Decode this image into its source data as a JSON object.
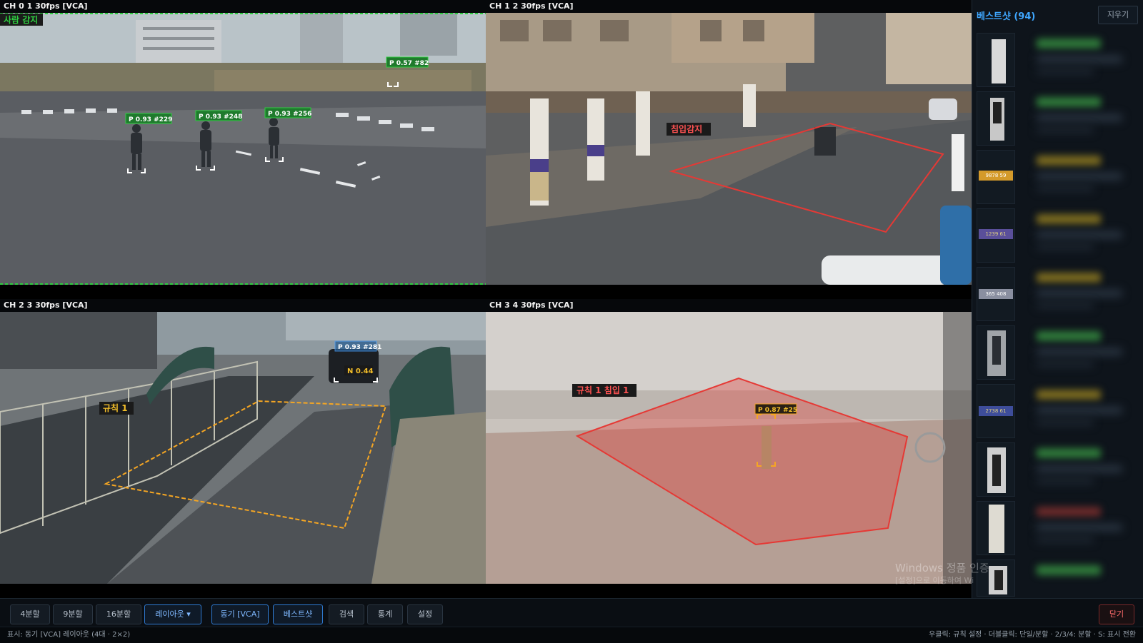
{
  "channels": [
    {
      "header": "CH 0  1   30fps [VCA]",
      "event": "사람 감지",
      "detections": [
        "P 0.57 #82",
        "P 0.93 #229",
        "P 0.93 #248",
        "P 0.93 #256"
      ]
    },
    {
      "header": "CH 1  2   30fps [VCA]",
      "event": "침입감지"
    },
    {
      "header": "CH 2  3   30fps [VCA]",
      "rule": "규칙 1",
      "detections": [
        "P 0.93 #281",
        "N 0.44"
      ]
    },
    {
      "header": "CH 3  4   30fps [VCA]",
      "rule": "규칙 1  침입 1",
      "detections": [
        "P 0.87 #25"
      ]
    }
  ],
  "sidebar": {
    "title": "베스트샷 (94)",
    "clear_label": "지우기",
    "plates": [
      "9878 59",
      "1239 61",
      "365 408",
      "2738 61"
    ]
  },
  "toolbar": {
    "split4": "4분할",
    "split9": "9분할",
    "split16": "16분할",
    "layout": "레이아웃 ▾",
    "sync": "동기 [VCA]",
    "bestshot": "베스트샷",
    "search": "검색",
    "stats": "통계",
    "settings": "설정",
    "close": "닫기"
  },
  "status": {
    "left": "표시: 동기 [VCA]     레이아웃 (4대 · 2×2)",
    "right": "우클릭: 규칙 설정 · 더블클릭: 단일/분할 · 2/3/4: 분할 · S: 표시 전환"
  },
  "watermark": {
    "line1": "Windows 정품 인증",
    "line2": "[설정]으로 이동하여 Wi"
  },
  "colors": {
    "accent": "#2f7bd3",
    "detect": "#2ecc40",
    "alarm": "#e53935",
    "rule": "#f5a623"
  }
}
